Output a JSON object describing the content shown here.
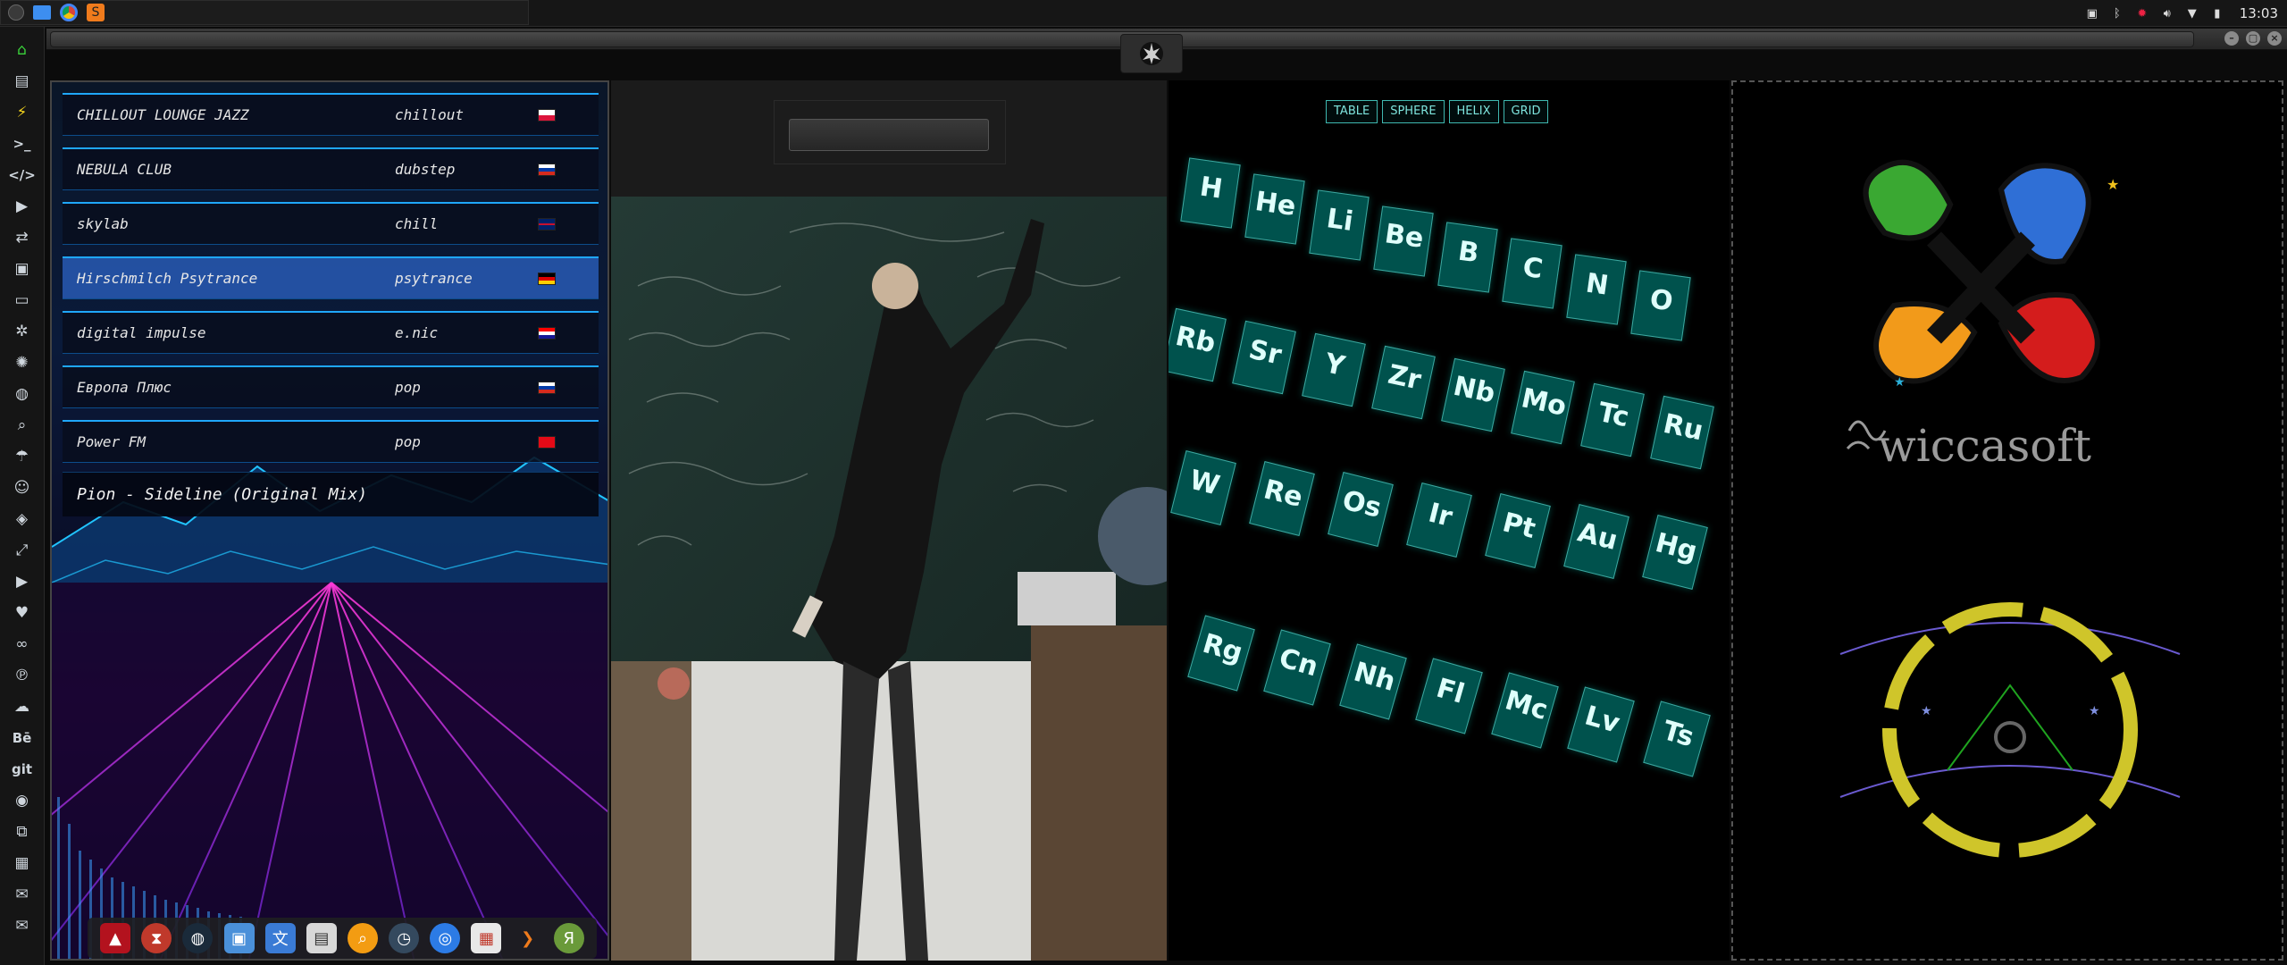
{
  "system": {
    "clock": "13:03",
    "tray_icons": [
      "image-icon",
      "bluetooth-icon",
      "gear-icon",
      "volume-icon",
      "wifi-icon",
      "battery-icon"
    ]
  },
  "leftdock": {
    "items": [
      {
        "icon": "home-icon",
        "glyph": "⌂"
      },
      {
        "icon": "file-icon",
        "glyph": "▤"
      },
      {
        "icon": "bolt-icon",
        "glyph": "⚡"
      },
      {
        "icon": "terminal-icon",
        "glyph": ">_"
      },
      {
        "icon": "code-icon",
        "glyph": "</>"
      },
      {
        "icon": "play-icon",
        "glyph": "▶"
      },
      {
        "icon": "translate-icon",
        "glyph": "⇄"
      },
      {
        "icon": "image-icon",
        "glyph": "▣"
      },
      {
        "icon": "contact-card-icon",
        "glyph": "▭"
      },
      {
        "icon": "settings-icon",
        "glyph": "✲"
      },
      {
        "icon": "openai-icon",
        "glyph": "✺"
      },
      {
        "icon": "globe-icon",
        "glyph": "◍"
      },
      {
        "icon": "search-icon",
        "glyph": "⌕"
      },
      {
        "icon": "umbrella-icon",
        "glyph": "☂"
      },
      {
        "icon": "contacts-icon",
        "glyph": "☺"
      },
      {
        "icon": "dropbox-icon",
        "glyph": "◈"
      },
      {
        "icon": "expand-icon",
        "glyph": "⤢"
      },
      {
        "icon": "youtube-icon",
        "glyph": "▶"
      },
      {
        "icon": "heart-icon",
        "glyph": "♥"
      },
      {
        "icon": "lastfm-icon",
        "glyph": "∞"
      },
      {
        "icon": "pinterest-icon",
        "glyph": "℗"
      },
      {
        "icon": "cloud-icon",
        "glyph": "☁"
      },
      {
        "icon": "behance-icon",
        "glyph": "Bē"
      },
      {
        "icon": "git-icon",
        "glyph": "git"
      },
      {
        "icon": "github-icon",
        "glyph": "◉"
      },
      {
        "icon": "cubes-icon",
        "glyph": "⧉"
      },
      {
        "icon": "map-icon",
        "glyph": "▦"
      },
      {
        "icon": "mail-icon",
        "glyph": "✉"
      },
      {
        "icon": "envelope-icon",
        "glyph": "✉"
      }
    ]
  },
  "radio": {
    "stations": [
      {
        "name": "CHILLOUT LOUNGE JAZZ",
        "genre": "chillout",
        "flag": "pl",
        "active": false
      },
      {
        "name": "NEBULA CLUB",
        "genre": "dubstep",
        "flag": "ru",
        "active": false
      },
      {
        "name": "skylab",
        "genre": "chill",
        "flag": "gb",
        "active": false
      },
      {
        "name": "Hirschmilch Psytrance",
        "genre": "psytrance",
        "flag": "de",
        "active": true
      },
      {
        "name": "digital impulse",
        "genre": "e.nic",
        "flag": "hr",
        "active": false
      },
      {
        "name": "Европа Плюс",
        "genre": "pop",
        "flag": "ru",
        "active": false
      },
      {
        "name": "Power FM",
        "genre": "pop",
        "flag": "tr",
        "active": false
      }
    ],
    "now_playing": "Pion - Sideline (Original Mix)"
  },
  "photo": {
    "search_placeholder": ""
  },
  "periodic": {
    "view_buttons": [
      "TABLE",
      "SPHERE",
      "HELIX",
      "GRID"
    ],
    "elements": [
      "H",
      "He",
      "Li",
      "Be",
      "B",
      "C",
      "N",
      "O",
      "Rb",
      "Sr",
      "Y",
      "Zr",
      "Nb",
      "Mo",
      "Tc",
      "Ru",
      "W",
      "Re",
      "Os",
      "Ir",
      "Pt",
      "Au",
      "Hg",
      "Rg",
      "Cn",
      "Nh",
      "Fl",
      "Mc",
      "Lv",
      "Ts"
    ]
  },
  "brand": {
    "name": "wiccasoft"
  },
  "colors": {
    "accent_cyan": "#1fa7ff",
    "tile_teal": "#00968c",
    "logo_green": "#3aa832",
    "logo_blue": "#2f6fd6",
    "logo_orange": "#f29a1a",
    "logo_red": "#d41c1c",
    "ring_yellow": "#cfc52a"
  }
}
